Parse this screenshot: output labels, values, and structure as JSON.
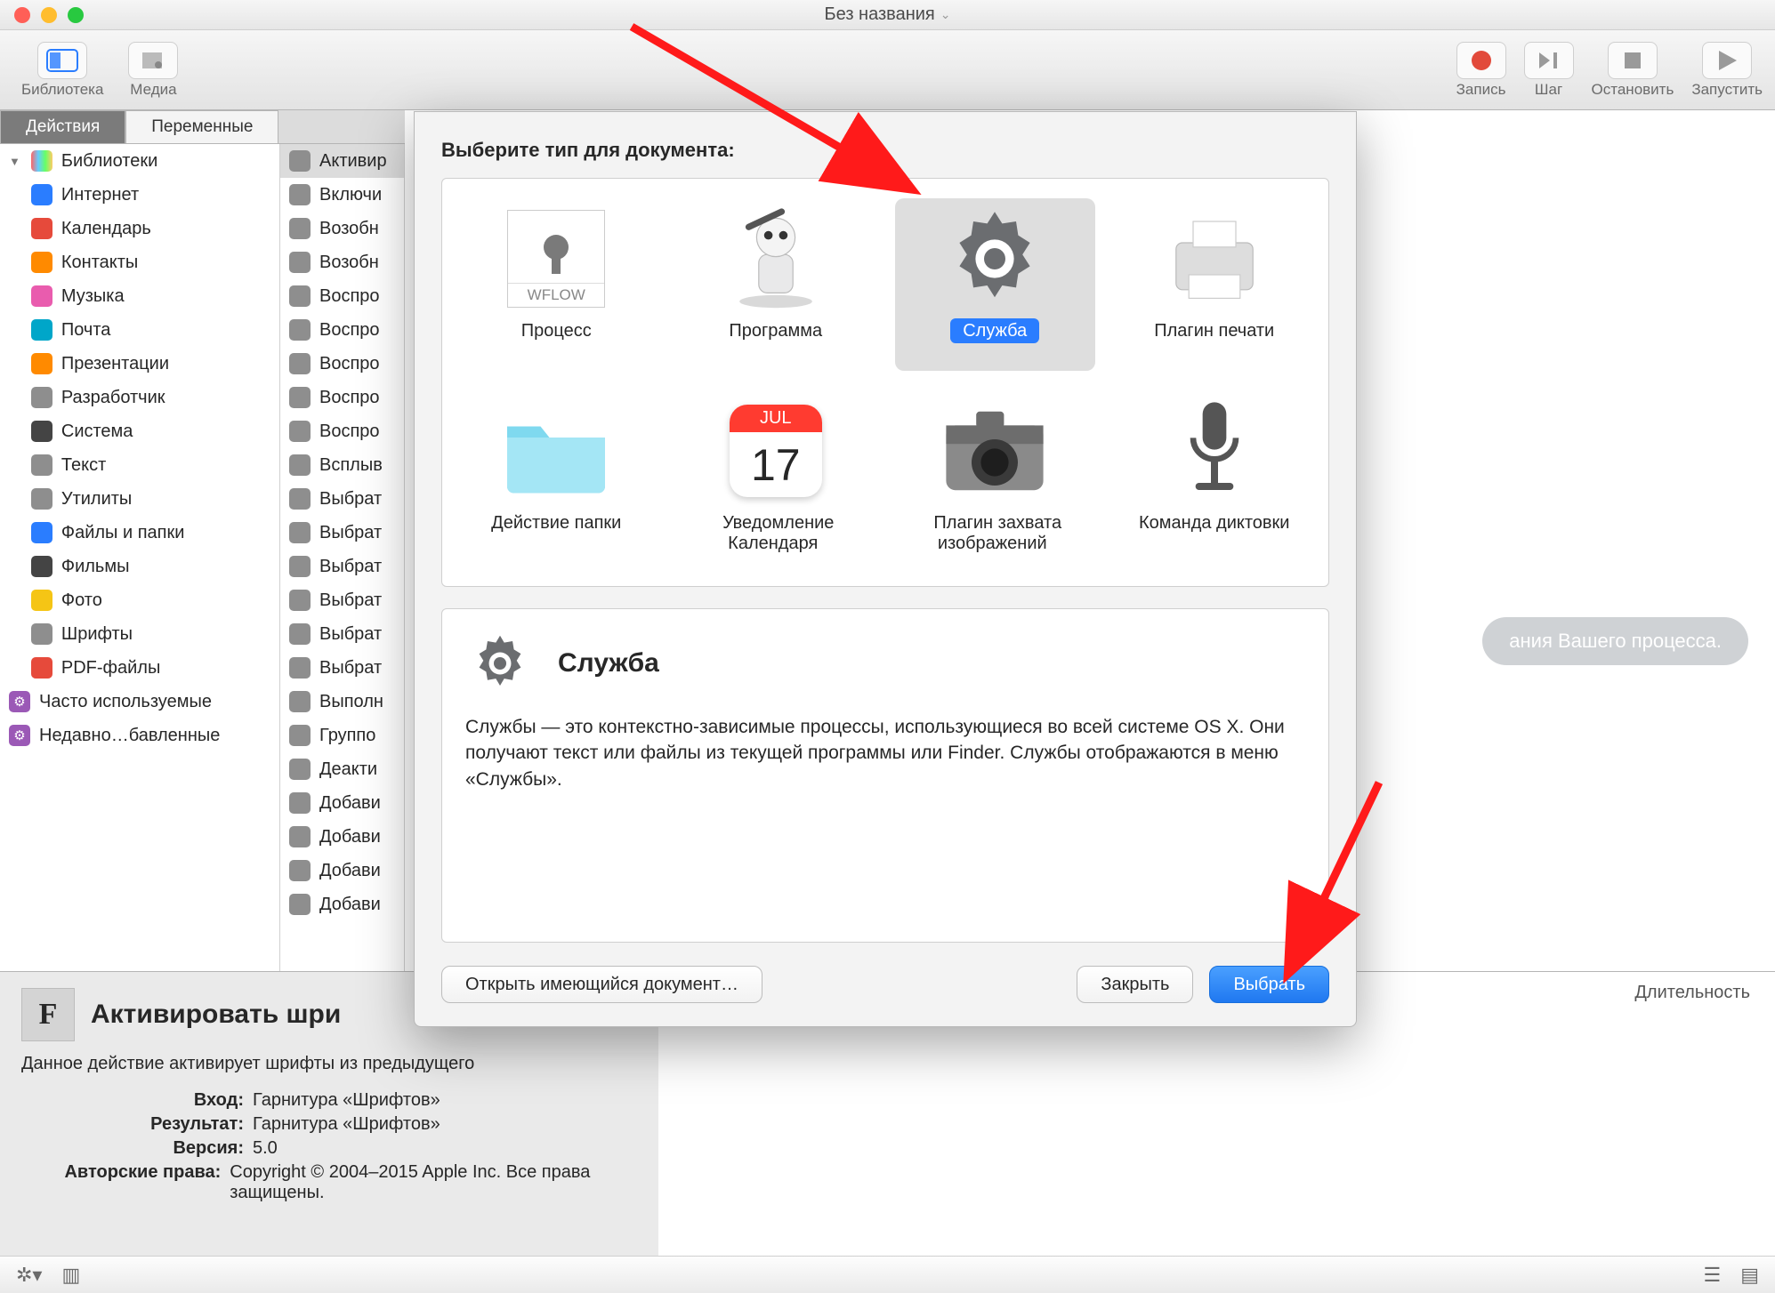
{
  "window": {
    "title": "Без названия"
  },
  "toolbar": {
    "left": [
      {
        "label": "Библиотека",
        "name": "library-button"
      },
      {
        "label": "Медиа",
        "name": "media-button"
      }
    ],
    "right": [
      {
        "label": "Запись",
        "name": "record-button",
        "color": "#e24a3b"
      },
      {
        "label": "Шаг",
        "name": "step-button"
      },
      {
        "label": "Остановить",
        "name": "stop-button"
      },
      {
        "label": "Запустить",
        "name": "run-button"
      }
    ]
  },
  "tabs": {
    "actions": "Действия",
    "variables": "Переменные"
  },
  "sidebar_a": {
    "header": "Библиотеки",
    "items": [
      {
        "label": "Интернет",
        "cls": "blue"
      },
      {
        "label": "Календарь",
        "cls": "red"
      },
      {
        "label": "Контакты",
        "cls": "orange"
      },
      {
        "label": "Музыка",
        "cls": "pink"
      },
      {
        "label": "Почта",
        "cls": "cyan"
      },
      {
        "label": "Презентации",
        "cls": "orange"
      },
      {
        "label": "Разработчик",
        "cls": "grey"
      },
      {
        "label": "Система",
        "cls": "dark"
      },
      {
        "label": "Текст",
        "cls": "grey"
      },
      {
        "label": "Утилиты",
        "cls": "grey"
      },
      {
        "label": "Файлы и папки",
        "cls": "blue"
      },
      {
        "label": "Фильмы",
        "cls": "dark"
      },
      {
        "label": "Фото",
        "cls": "yellow"
      },
      {
        "label": "Шрифты",
        "cls": "grey"
      },
      {
        "label": "PDF-файлы",
        "cls": "red"
      }
    ],
    "smart": [
      {
        "label": "Часто используемые"
      },
      {
        "label": "Недавно…бавленные"
      }
    ]
  },
  "sidebar_b": [
    "Активир",
    "Включи",
    "Возобн",
    "Возобн",
    "Воспро",
    "Воспро",
    "Воспро",
    "Воспро",
    "Воспро",
    "Всплыв",
    "Выбрат",
    "Выбрат",
    "Выбрат",
    "Выбрат",
    "Выбрат",
    "Выбрат",
    "Выполн",
    "Группо",
    "Деакти",
    "Добави",
    "Добави",
    "Добави",
    "Добави"
  ],
  "canvas": {
    "hint_tail": "ания Вашего процесса."
  },
  "footer": {
    "title": "Активировать шри",
    "desc": "Данное действие активирует шрифты из предыдущего",
    "kv": [
      {
        "k": "Вход:",
        "v": "Гарнитура «Шрифтов»"
      },
      {
        "k": "Результат:",
        "v": "Гарнитура «Шрифтов»"
      },
      {
        "k": "Версия:",
        "v": "5.0"
      },
      {
        "k": "Авторские права:",
        "v": "Copyright © 2004–2015 Apple Inc. Все права защищены."
      }
    ],
    "duration": "Длительность"
  },
  "sheet": {
    "heading": "Выберите тип для документа:",
    "templates": [
      {
        "label": "Процесс",
        "name": "workflow-template",
        "icon": "wflow"
      },
      {
        "label": "Программа",
        "name": "application-template",
        "icon": "robot"
      },
      {
        "label": "Служба",
        "name": "service-template",
        "icon": "gear",
        "selected": true
      },
      {
        "label": "Плагин печати",
        "name": "print-plugin-template",
        "icon": "printer"
      },
      {
        "label": "Действие папки",
        "name": "folder-action-template",
        "icon": "folder"
      },
      {
        "label": "Уведомление Календаря",
        "name": "calendar-alarm-template",
        "icon": "calendar"
      },
      {
        "label": "Плагин захвата изображений",
        "name": "image-capture-template",
        "icon": "camera"
      },
      {
        "label": "Команда диктовки",
        "name": "dictation-template",
        "icon": "mic"
      }
    ],
    "desc_title": "Служба",
    "desc_body": "Службы — это контекстно-зависимые процессы, использующиеся во всей системе OS X. Они получают текст или файлы из текущей программы или Finder. Службы отображаются в меню «Службы».",
    "buttons": {
      "open": "Открыть имеющийся документ…",
      "close": "Закрыть",
      "choose": "Выбрать"
    }
  },
  "icons": {
    "calendar_month": "JUL",
    "calendar_day": "17",
    "wflow": "WFLOW"
  }
}
